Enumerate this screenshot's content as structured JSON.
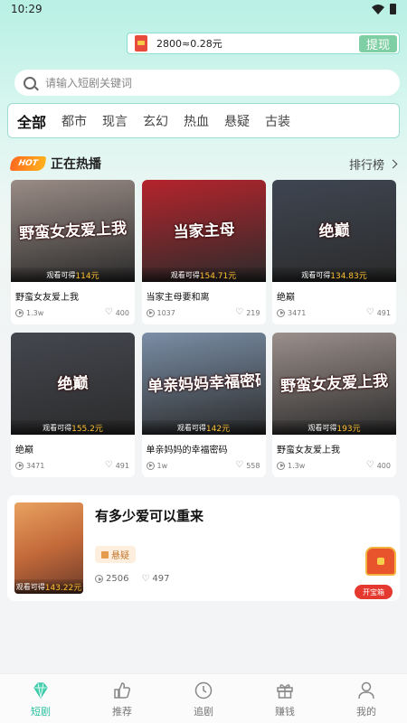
{
  "status_bar": {
    "time": "10:29"
  },
  "reward": {
    "text": "2800≈0.28元",
    "withdraw_label": "提现"
  },
  "search": {
    "placeholder": "请输入短剧关键词"
  },
  "tabs": [
    {
      "label": "全部",
      "active": true
    },
    {
      "label": "都市"
    },
    {
      "label": "现言"
    },
    {
      "label": "玄幻"
    },
    {
      "label": "热血"
    },
    {
      "label": "悬疑"
    },
    {
      "label": "古装"
    }
  ],
  "hot_section": {
    "badge": "HOT",
    "title": "正在热播",
    "rank_label": "排行榜"
  },
  "dramas": [
    {
      "poster_text": "野蛮女友爱上我",
      "reward_prefix": "观看可得",
      "reward": "114元",
      "name": "野蛮女友爱上我",
      "plays": "1.3w",
      "likes": "400",
      "color": "#9a8c86"
    },
    {
      "poster_text": "当家主母",
      "reward_prefix": "观看可得",
      "reward": "154.71元",
      "name": "当家主母要和离",
      "plays": "1037",
      "likes": "219",
      "color": "#b5242c"
    },
    {
      "poster_text": "绝巅",
      "reward_prefix": "观看可得",
      "reward": "134.83元",
      "name": "绝巅",
      "plays": "3471",
      "likes": "491",
      "color": "#3f4652"
    },
    {
      "poster_text": "绝巅",
      "reward_prefix": "观看可得",
      "reward": "155.2元",
      "name": "绝巅",
      "plays": "3471",
      "likes": "491",
      "color": "#44474f"
    },
    {
      "poster_text": "单亲妈妈幸福密码",
      "reward_prefix": "观看可得",
      "reward": "142元",
      "name": "单亲妈妈的幸福密码",
      "plays": "1w",
      "likes": "558",
      "color": "#7a8ea6"
    },
    {
      "poster_text": "野蛮女友爱上我",
      "reward_prefix": "观看可得",
      "reward": "193元",
      "name": "野蛮女友爱上我",
      "plays": "1.3w",
      "likes": "400",
      "color": "#9b8f8b"
    }
  ],
  "featured": {
    "title": "有多少爱可以重来",
    "genre": "悬疑",
    "reward_prefix": "观看可得",
    "reward": "143.22元",
    "plays": "2506",
    "likes": "497",
    "treasure_label": "开宝箱"
  },
  "nav": [
    {
      "label": "短剧",
      "icon": "diamond-icon",
      "active": true
    },
    {
      "label": "推荐",
      "icon": "thumbs-up-icon"
    },
    {
      "label": "追剧",
      "icon": "clock-icon"
    },
    {
      "label": "赚钱",
      "icon": "gift-icon"
    },
    {
      "label": "我的",
      "icon": "user-icon"
    }
  ]
}
